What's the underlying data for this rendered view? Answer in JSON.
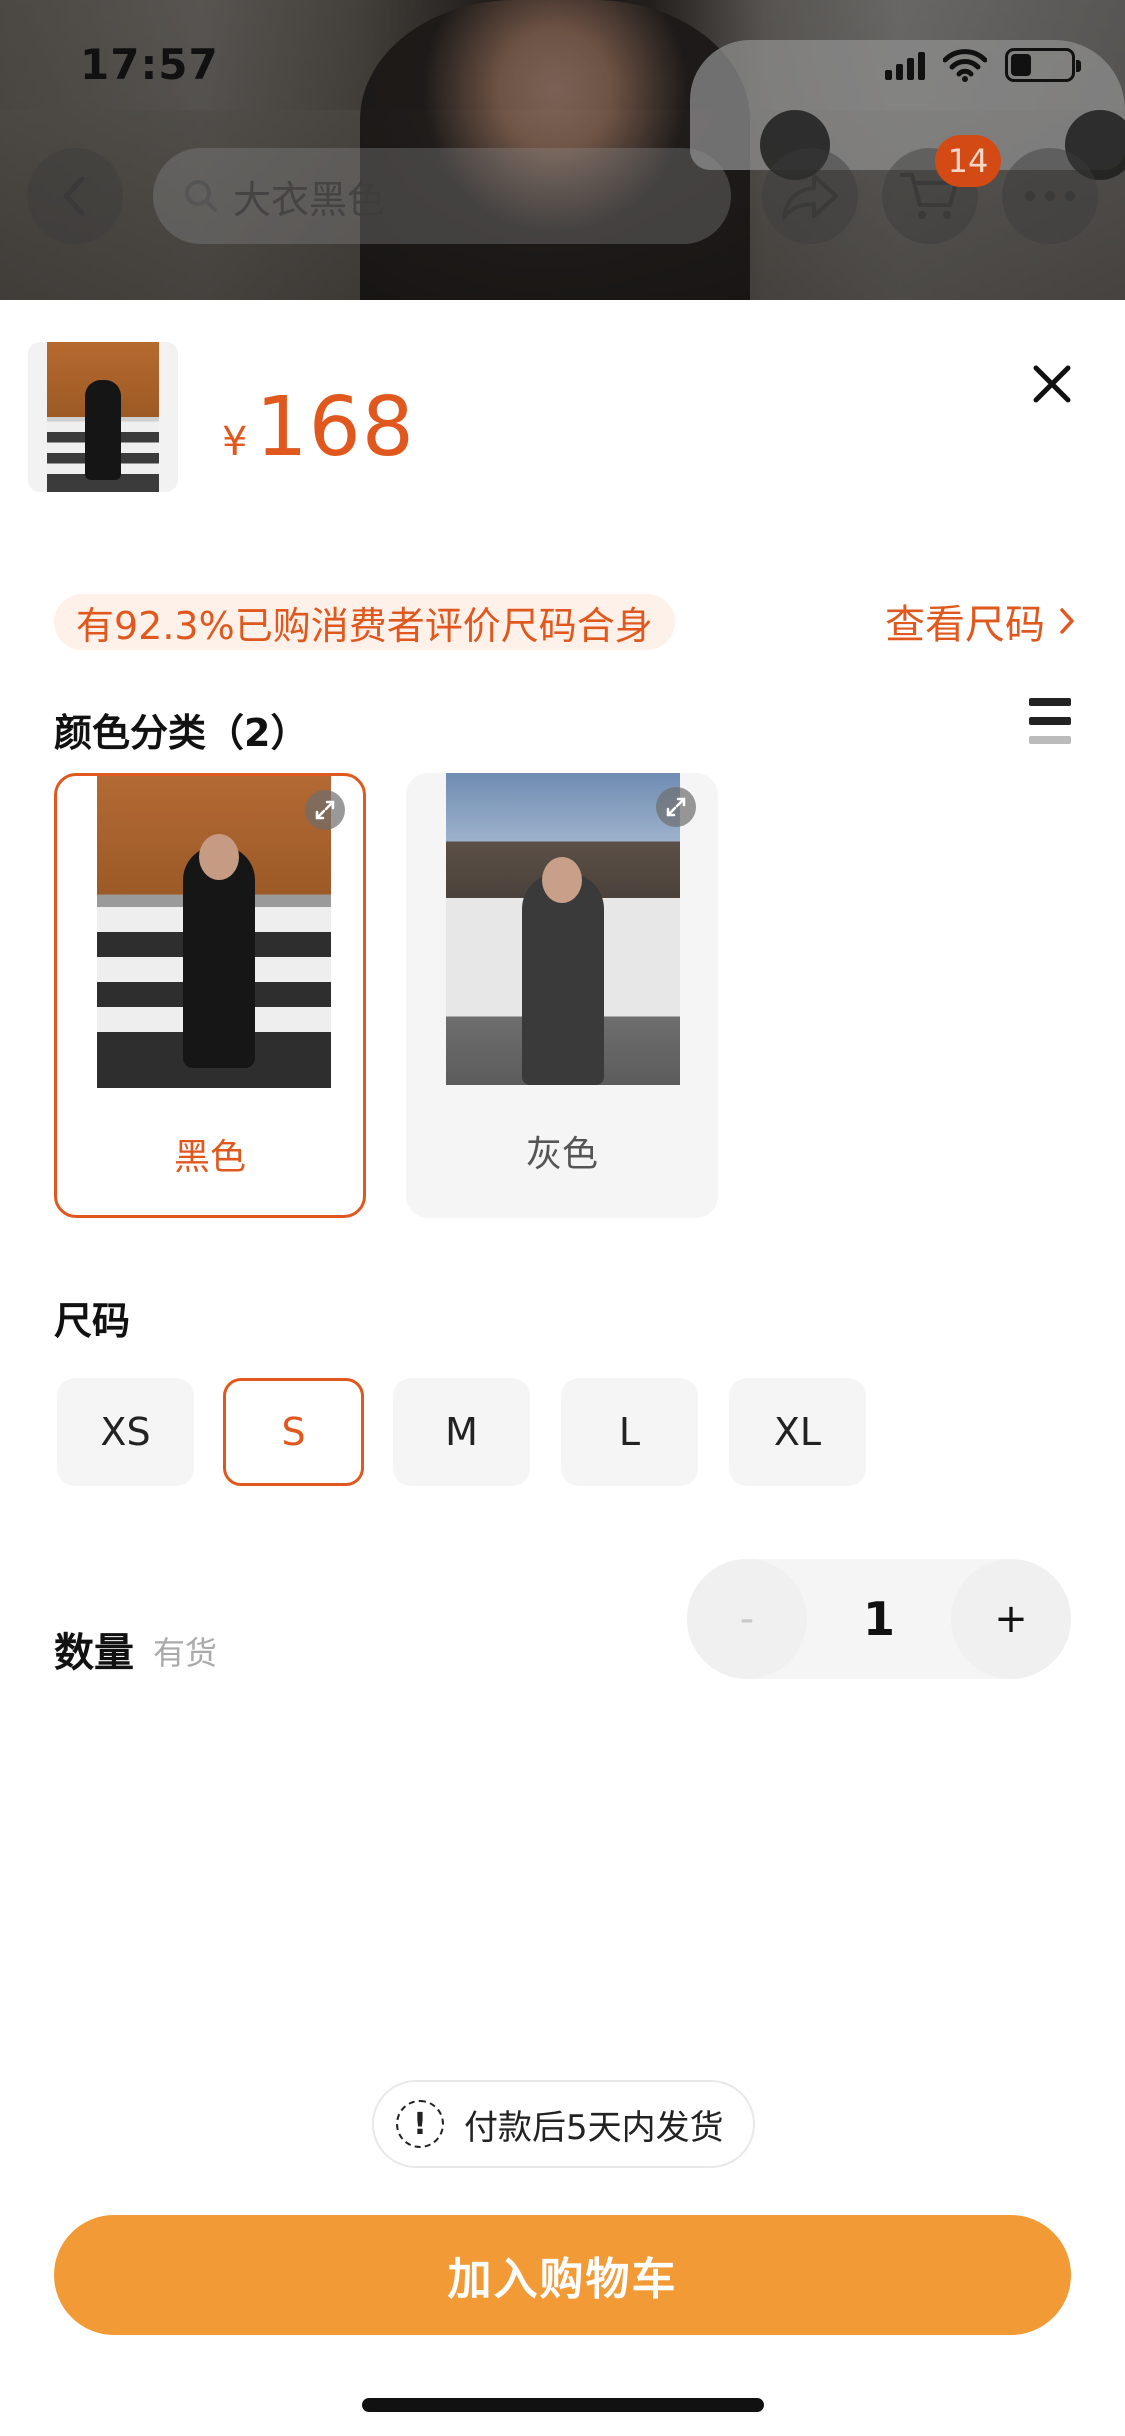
{
  "status_bar": {
    "time": "17:57"
  },
  "top_nav": {
    "search_placeholder": "大衣黑色",
    "cart_count": "14",
    "icons": [
      "back-arrow-icon",
      "search-icon",
      "share-icon",
      "cart-icon",
      "more-icon"
    ]
  },
  "product": {
    "currency_symbol": "¥",
    "price": "168"
  },
  "fit_info": {
    "tag": "有92.3%已购消费者评价尺码合身",
    "size_chart_link": "查看尺码"
  },
  "color_section": {
    "title": "颜色分类（2）",
    "options": [
      {
        "label": "黑色",
        "selected": true
      },
      {
        "label": "灰色",
        "selected": false
      }
    ]
  },
  "size_section": {
    "title": "尺码",
    "options": [
      {
        "label": "XS",
        "selected": false
      },
      {
        "label": "S",
        "selected": true
      },
      {
        "label": "M",
        "selected": false
      },
      {
        "label": "L",
        "selected": false
      },
      {
        "label": "XL",
        "selected": false
      }
    ]
  },
  "quantity": {
    "label": "数量",
    "stock": "有货",
    "minus": "-",
    "value": "1",
    "plus": "+"
  },
  "shipping_note": "付款后5天内发货",
  "cta": {
    "add_to_cart": "加入购物车"
  },
  "colors": {
    "accent": "#e0581d",
    "cta": "#f29a36"
  }
}
